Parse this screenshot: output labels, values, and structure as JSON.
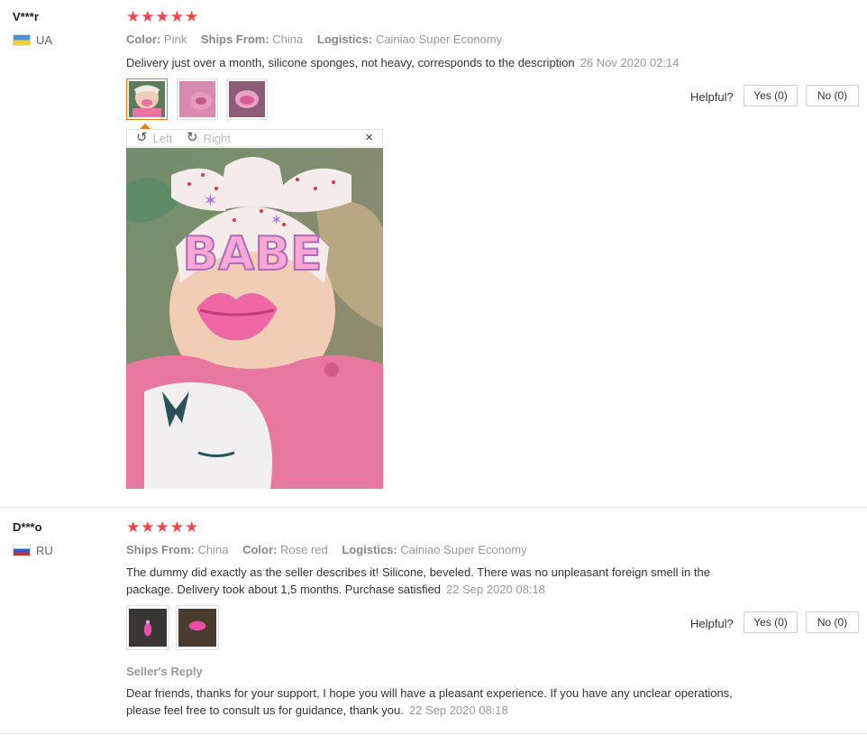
{
  "reviews": [
    {
      "user": "V***r",
      "country": "UA",
      "stars": "★★★★★",
      "props": [
        {
          "k": "Color:",
          "v": "Pink"
        },
        {
          "k": "Ships From:",
          "v": "China"
        },
        {
          "k": "Logistics:",
          "v": "Cainiao Super Economy"
        }
      ],
      "text": "Delivery just over a month, silicone sponges, not heavy, corresponds to the description",
      "date": "26 Nov 2020 02:14",
      "helpful": "Helpful?",
      "yes": "Yes (0)",
      "no": "No (0)",
      "viewer": {
        "left": "Left",
        "right": "Right",
        "close": "×"
      },
      "photo_text": "BABE"
    },
    {
      "user": "D***o",
      "country": "RU",
      "stars": "★★★★★",
      "props": [
        {
          "k": "Ships From:",
          "v": "China"
        },
        {
          "k": "Color:",
          "v": "Rose red"
        },
        {
          "k": "Logistics:",
          "v": "Cainiao Super Economy"
        }
      ],
      "text": "The dummy did exactly as the seller describes it! Silicone, beveled. There was no unpleasant foreign smell in the package. Delivery took about 1,5 months. Purchase satisfied",
      "date": "22 Sep 2020 08:18",
      "helpful": "Helpful?",
      "yes": "Yes (0)",
      "no": "No (0)",
      "seller_reply": {
        "title": "Seller's Reply",
        "text": "Dear friends, thanks for your support, I hope you will have a pleasant experience. If you have any unclear operations, please feel free to consult us for guidance, thank you.",
        "date": "22 Sep 2020 08:18"
      }
    }
  ],
  "colors": {
    "star": "#f3454a",
    "accent": "#e87a18"
  }
}
